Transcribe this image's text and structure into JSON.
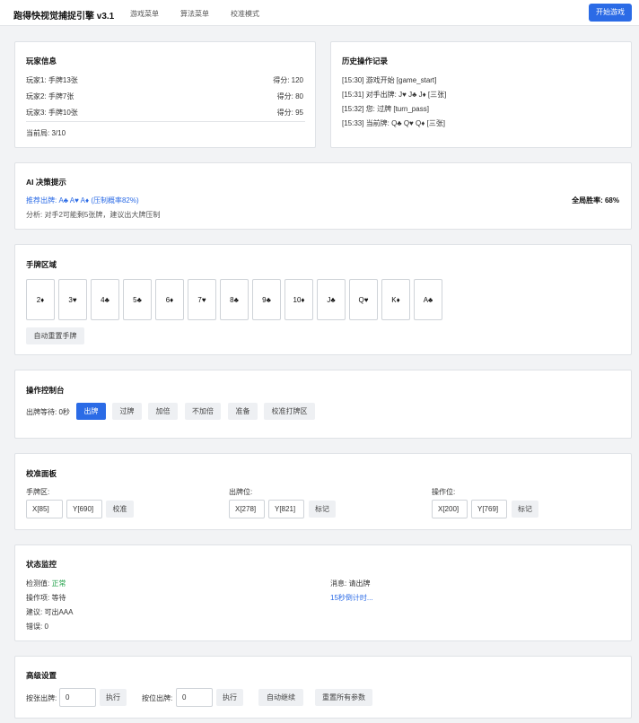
{
  "header": {
    "title": "跑得快视觉捕捉引擎 v3.1",
    "nav": [
      "游戏菜单",
      "算法菜单",
      "校准模式"
    ],
    "start_button": "开始游戏"
  },
  "player_info": {
    "title": "玩家信息",
    "players": [
      {
        "label": "玩家1: 手牌13张",
        "score": "得分: 120"
      },
      {
        "label": "玩家2: 手牌7张",
        "score": "得分: 80"
      },
      {
        "label": "玩家3: 手牌10张",
        "score": "得分: 95"
      }
    ],
    "round": "当前局: 3/10"
  },
  "history": {
    "title": "历史操作记录",
    "entries": [
      "[15:30] 游戏开始 [game_start]",
      "[15:31] 对手出牌: J♥ J♣ J♦ [三张]",
      "[15:32] 您: 过牌 [turn_pass]",
      "[15:33] 当前牌: Q♣ Q♥ Q♦ [三张]"
    ]
  },
  "ai": {
    "title": "AI 决策提示",
    "recommend": "推荐出牌: A♣ A♥ A♦ (压制概率82%)",
    "analysis": "分析: 对手2可能剩5张牌，建议出大牌压制",
    "win_rate": "全局胜率: 68%"
  },
  "hand": {
    "title": "手牌区域",
    "cards": [
      "2♦",
      "3♥",
      "4♣",
      "5♣",
      "6♦",
      "7♥",
      "8♣",
      "9♣",
      "10♦",
      "J♣",
      "Q♥",
      "K♦",
      "A♣"
    ],
    "reset_button": "自动重置手牌"
  },
  "controls": {
    "title": "操作控制台",
    "wait_label": "出牌等待: 0秒",
    "buttons": [
      "出牌",
      "过牌",
      "加倍",
      "不加倍",
      "准备",
      "校准打牌区"
    ]
  },
  "calibration": {
    "title": "校准面板",
    "groups": [
      {
        "label": "手牌区:",
        "x": "X[85]",
        "y": "Y[690]",
        "button": "校准"
      },
      {
        "label": "出牌位:",
        "x": "X[278]",
        "y": "Y[821]",
        "button": "标记"
      },
      {
        "label": "操作位:",
        "x": "X[200]",
        "y": "Y[769]",
        "button": "标记"
      }
    ]
  },
  "status": {
    "title": "状态监控",
    "detect_label": "检测值: ",
    "detect_value": "正常",
    "operation": "操作项: 等待",
    "suggestion": "建议: 可出AAA",
    "errors": "错误: 0",
    "message": "消息: 请出牌",
    "countdown": "15秒倒计时..."
  },
  "advanced": {
    "title": "高级设置",
    "by_card_label": "按张出牌:",
    "by_card_value": "0",
    "execute1": "执行",
    "by_pos_label": "按位出牌:",
    "by_pos_value": "0",
    "execute2": "执行",
    "auto_continue": "自动继续",
    "reset_all": "重置所有参数"
  },
  "colors": {
    "accent": "#2b6be6",
    "ok": "#22a04a"
  }
}
